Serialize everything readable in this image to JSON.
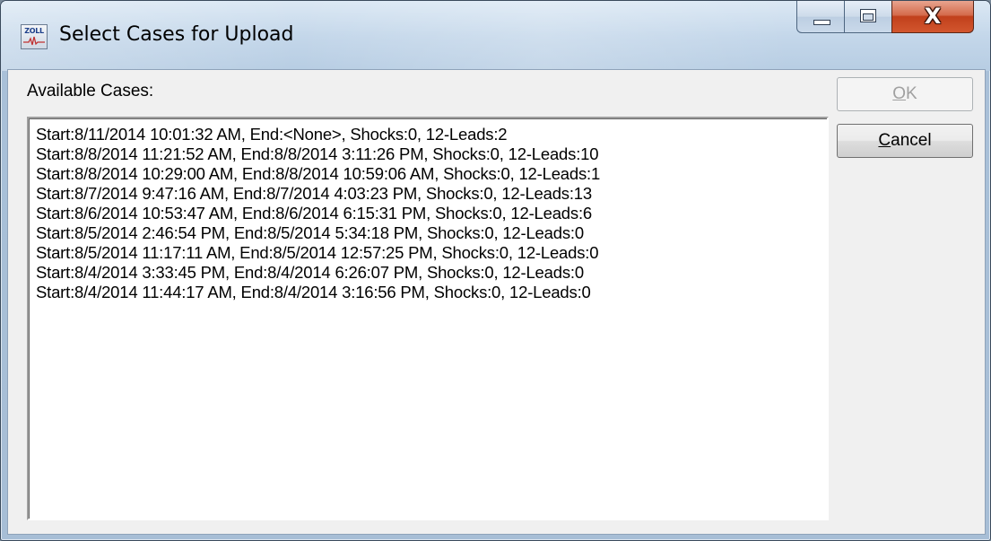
{
  "window": {
    "title": "Select Cases for Upload",
    "app_icon_text": "ZOLL",
    "caption": {
      "minimize_icon": "minimize-icon",
      "maximize_icon": "maximize-icon",
      "close_glyph": "X"
    }
  },
  "content": {
    "available_label": "Available Cases:",
    "cases": [
      "Start:8/11/2014 10:01:32 AM, End:<None>, Shocks:0, 12-Leads:2",
      "Start:8/8/2014 11:21:52 AM, End:8/8/2014 3:11:26 PM, Shocks:0, 12-Leads:10",
      "Start:8/8/2014 10:29:00 AM, End:8/8/2014 10:59:06 AM, Shocks:0, 12-Leads:1",
      "Start:8/7/2014 9:47:16 AM, End:8/7/2014 4:03:23 PM, Shocks:0, 12-Leads:13",
      "Start:8/6/2014 10:53:47 AM, End:8/6/2014 6:15:31 PM, Shocks:0, 12-Leads:6",
      "Start:8/5/2014 2:46:54 PM, End:8/5/2014 5:34:18 PM, Shocks:0, 12-Leads:0",
      "Start:8/5/2014 11:17:11 AM, End:8/5/2014 12:57:25 PM, Shocks:0, 12-Leads:0",
      "Start:8/4/2014 3:33:45 PM, End:8/4/2014 6:26:07 PM, Shocks:0, 12-Leads:0",
      "Start:8/4/2014 11:44:17 AM, End:8/4/2014 3:16:56 PM, Shocks:0, 12-Leads:0"
    ]
  },
  "buttons": {
    "ok": {
      "mnemonic": "O",
      "rest": "K",
      "enabled": false
    },
    "cancel": {
      "mnemonic": "C",
      "rest": "ancel",
      "enabled": true
    }
  },
  "colors": {
    "close_button": "#c1401c",
    "dialog_face": "#f0f0f0",
    "disabled_text": "#a0a0a0"
  }
}
